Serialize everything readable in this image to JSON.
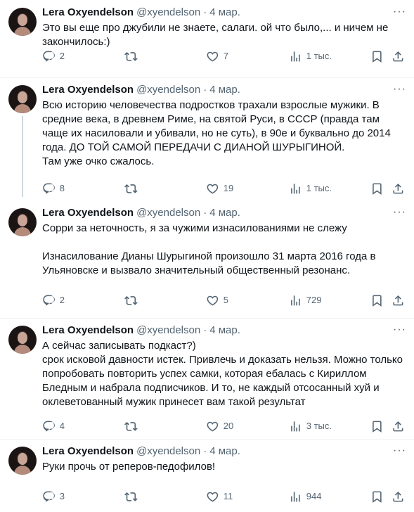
{
  "tweets": [
    {
      "name": "Lera Oxyendelson",
      "handle": "@xyendelson",
      "date": "4 мар.",
      "text": "Это вы еще про джубили не знаете, салаги. ой что было,... и ничем не закончилось:)",
      "replies": "2",
      "retweets": "",
      "likes": "7",
      "views": "1 тыс."
    },
    {
      "name": "Lera Oxyendelson",
      "handle": "@xyendelson",
      "date": "4 мар.",
      "text": "Всю историю человечества подростков трахали взрослые мужики. В средние века, в древнем Риме, на святой Руси, в СССР (правда там чаще их насиловали и убивали, но не суть), в 90е и буквально до 2014 года. ДО ТОЙ САМОЙ ПЕРЕДАЧИ С ДИАНОЙ ШУРЫГИНОЙ.\nТам уже очко сжалось.",
      "replies": "8",
      "retweets": "",
      "likes": "19",
      "views": "1 тыс."
    },
    {
      "name": "Lera Oxyendelson",
      "handle": "@xyendelson",
      "date": "4 мар.",
      "text": "Сорри за неточность, я за чужими изнасилованиями не слежу\n\nИзнасилование Дианы Шурыгиной произошло 31 марта 2016 года в Ульяновске и вызвало значительный общественный резонанс.",
      "replies": "2",
      "retweets": "",
      "likes": "5",
      "views": "729"
    },
    {
      "name": "Lera Oxyendelson",
      "handle": "@xyendelson",
      "date": "4 мар.",
      "text": "А сейчас записывать подкаст?)\nсрок исковой давности истек. Привлечь и доказать нельзя. Можно только попробовать повторить успех самки, которая ебалась с Кириллом Бледным и набрала подписчиков. И то, не каждый отсосанный хуй  и оклеветованный мужик принесет вам такой результат",
      "replies": "4",
      "retweets": "",
      "likes": "20",
      "views": "3 тыс."
    },
    {
      "name": "Lera Oxyendelson",
      "handle": "@xyendelson",
      "date": "4 мар.",
      "text": "Руки прочь от реперов-педофилов!",
      "replies": "3",
      "retweets": "",
      "likes": "11",
      "views": "944"
    }
  ],
  "icons": {
    "more": "more-dots-icon",
    "reply": "reply-bubble-icon",
    "retweet": "retweet-arrows-icon",
    "like": "heart-icon",
    "views": "views-bar-chart-icon",
    "bookmark": "bookmark-icon",
    "share": "share-upload-icon"
  },
  "colors": {
    "text": "#0f1419",
    "secondary": "#536471",
    "divider": "#eff3f4",
    "thread_line": "#cfd9de"
  }
}
